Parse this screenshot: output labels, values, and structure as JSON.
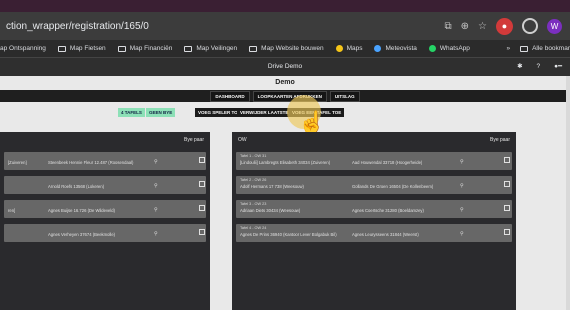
{
  "browser": {
    "url": "ction_wrapper/registration/165/0",
    "profile_initial": "W",
    "bookmarks": [
      {
        "label": "ap Ontspanning",
        "type": "text"
      },
      {
        "label": "Map Fietsen",
        "type": "folder"
      },
      {
        "label": "Map Financiën",
        "type": "folder"
      },
      {
        "label": "Map Veilingen",
        "type": "folder"
      },
      {
        "label": "Map Website bouwen",
        "type": "folder"
      },
      {
        "label": "Maps",
        "type": "maps"
      },
      {
        "label": "Meteovista",
        "type": "meteo"
      },
      {
        "label": "WhatsApp",
        "type": "whatsapp"
      }
    ],
    "bookmarks_overflow": "»",
    "all_bookmarks": "Alle bookmar"
  },
  "app": {
    "window_title": "Drive Demo",
    "brand": "Demo",
    "nav": [
      "DASHBOARD",
      "LOOPKAARTEN AFDRUKKEN",
      "UITSLAG"
    ],
    "actions": {
      "tafels": "4 TAFELS",
      "geen_bye": "GEEN BYE",
      "voeg_speler": "VOEG SPELER TOE",
      "verwijder": "VERWIJDER LAATSTE TAFEL",
      "voeg_tafel": "VOEG EEN TAFEL TOE"
    },
    "left_panel": {
      "header_right": "Bye paar",
      "rows": [
        {
          "name": "[Zuiveren]",
          "mid": "Steenbeek Hennie Fleur 12.487 (Roosendaal)"
        },
        {
          "name": "",
          "mid": "Arnold Roefs 13568 (Lokeren)"
        },
        {
          "name": "ren]",
          "mid": "Agnes Buijse 16.726 (De Wildeveld)"
        },
        {
          "name": "",
          "mid": "Agnes Verheyen 37674 (Beekmolle)"
        }
      ]
    },
    "right_panel": {
      "header_left": "OW",
      "header_right": "Bye paar",
      "rows": [
        {
          "label": "Tafel 1 - OW 31",
          "name": "[Lindoulii] Lambregts Elisabeth 34034 (Zuiveren)",
          "mid": "Aad Houwendal 33718 (Hoogerheide)"
        },
        {
          "label": "Tafel 2 - OW 26",
          "name": "Adolf Hermans 17 738 (Weesouw)",
          "mid": "Gollands De Groen 16504 (De Kollenbeem)"
        },
        {
          "label": "Tafel 3 - OW 23",
          "name": "Adriaan Diets 30434 (Weesouw)",
          "mid": "Agnes Coertsche 31280 (Boeldamzey)"
        },
        {
          "label": "Tafel 4 - OW 24",
          "name": "Agnes De Prins 36940 (Kantoor Lever Bolgabuk Bil)",
          "mid": "Agnes Leurysseens 31844 (Weerst)"
        }
      ]
    }
  }
}
